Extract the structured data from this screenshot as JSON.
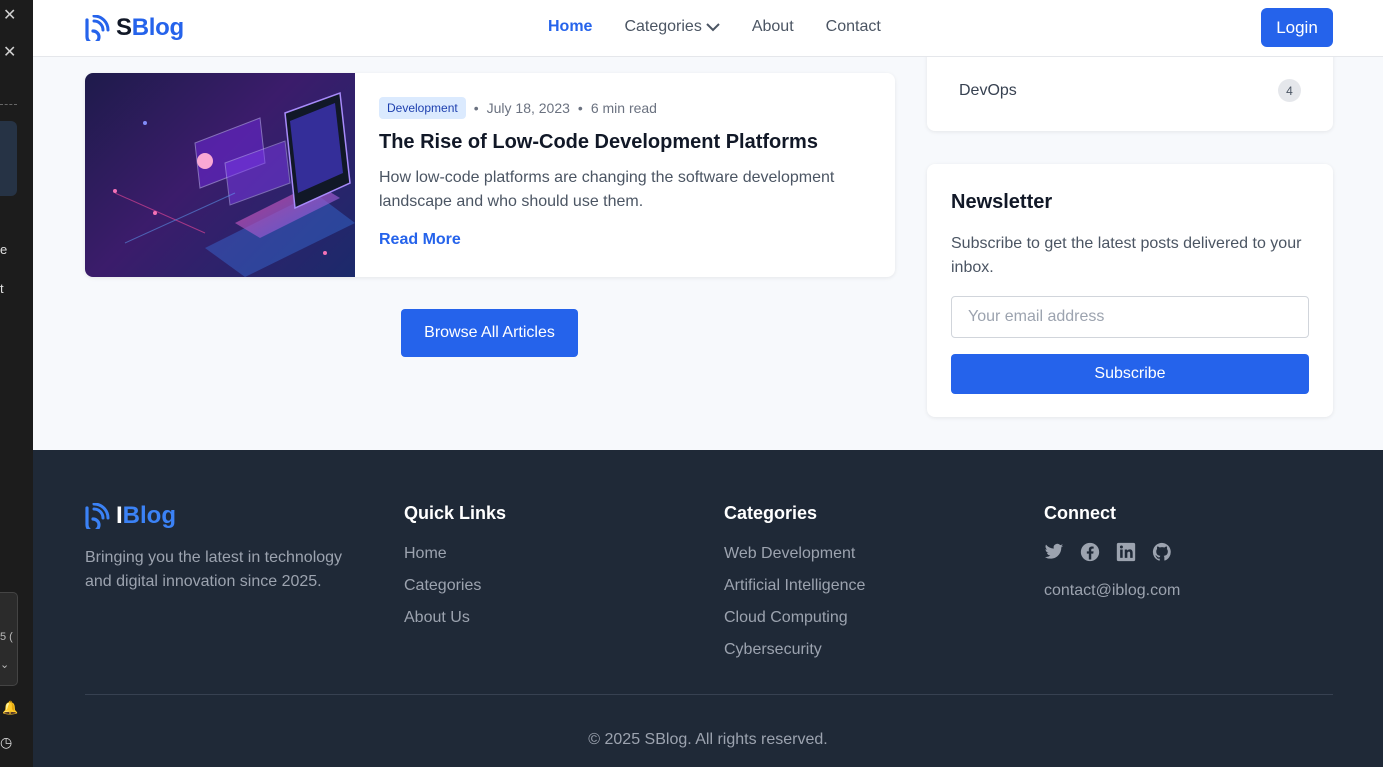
{
  "header": {
    "logo_prefix": "S",
    "logo_suffix": "Blog",
    "nav": [
      "Home",
      "Categories",
      "About",
      "Contact"
    ],
    "login_label": "Login"
  },
  "article": {
    "tag": "Development",
    "date": "July 18, 2023",
    "read_time": "6 min read",
    "title": "The Rise of Low-Code Development Platforms",
    "description": "How low-code platforms are changing the software development landscape and who should use them.",
    "read_more": "Read More"
  },
  "browse_label": "Browse All Articles",
  "categories_widget": {
    "item": "DevOps",
    "count": "4"
  },
  "newsletter": {
    "title": "Newsletter",
    "description": "Subscribe to get the latest posts delivered to your inbox.",
    "placeholder": "Your email address",
    "button": "Subscribe"
  },
  "footer": {
    "logo_prefix": "I",
    "logo_suffix": "Blog",
    "tagline": "Bringing you the latest in technology and digital innovation since 2025.",
    "quick_links": {
      "title": "Quick Links",
      "items": [
        "Home",
        "Categories",
        "About Us"
      ]
    },
    "categories": {
      "title": "Categories",
      "items": [
        "Web Development",
        "Artificial Intelligence",
        "Cloud Computing",
        "Cybersecurity"
      ]
    },
    "connect": {
      "title": "Connect",
      "icons": [
        "twitter-icon",
        "facebook-icon",
        "linkedin-icon",
        "github-icon"
      ],
      "email": "contact@iblog.com"
    },
    "copyright": "© 2025 SBlog. All rights reserved."
  },
  "side_panel": {
    "frag1": "e",
    "frag2": "t",
    "frag3": "5 ("
  },
  "colors": {
    "accent": "#2563eb",
    "footer_bg": "#1f2937"
  }
}
